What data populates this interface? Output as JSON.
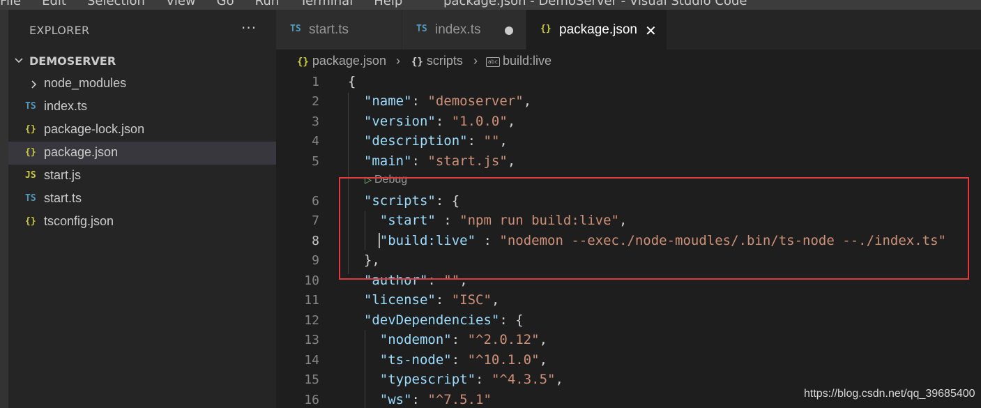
{
  "menubar": {
    "items": [
      "File",
      "Edit",
      "Selection",
      "View",
      "Go",
      "Run",
      "Terminal",
      "Help"
    ],
    "title": "package.json - DemoServer - Visual Studio Code"
  },
  "sidebar": {
    "header": "EXPLORER",
    "more": "···",
    "root": "DEMOSERVER",
    "items": [
      {
        "label": "node_modules",
        "icon": "chevron-right-icon",
        "type": "folder"
      },
      {
        "label": "index.ts",
        "icon": "TS",
        "type": "ts"
      },
      {
        "label": "package-lock.json",
        "icon": "{}",
        "type": "json"
      },
      {
        "label": "package.json",
        "icon": "{}",
        "type": "json",
        "selected": true
      },
      {
        "label": "start.js",
        "icon": "JS",
        "type": "js"
      },
      {
        "label": "start.ts",
        "icon": "TS",
        "type": "ts"
      },
      {
        "label": "tsconfig.json",
        "icon": "{}",
        "type": "json"
      }
    ]
  },
  "tabs": [
    {
      "label": "start.ts",
      "icon": "TS"
    },
    {
      "label": "index.ts",
      "icon": "TS",
      "modified": true
    },
    {
      "label": "package.json",
      "icon": "{}",
      "active": true,
      "close": "✕"
    }
  ],
  "breadcrumb": {
    "file_icon": "{}",
    "file": "package.json",
    "sep": "›",
    "section_icon": "{}",
    "section": "scripts",
    "leaf_icon": "abc",
    "leaf": "build:live"
  },
  "editor": {
    "codelens": "Debug",
    "lines": [
      {
        "n": "1",
        "code": [
          [
            "p",
            "{"
          ]
        ]
      },
      {
        "n": "2",
        "code": [
          [
            "p",
            "  "
          ],
          [
            "k",
            "\"name\""
          ],
          [
            "p",
            ": "
          ],
          [
            "s",
            "\"demoserver\""
          ],
          [
            "p",
            ","
          ]
        ]
      },
      {
        "n": "3",
        "code": [
          [
            "p",
            "  "
          ],
          [
            "k",
            "\"version\""
          ],
          [
            "p",
            ": "
          ],
          [
            "s",
            "\"1.0.0\""
          ],
          [
            "p",
            ","
          ]
        ]
      },
      {
        "n": "4",
        "code": [
          [
            "p",
            "  "
          ],
          [
            "k",
            "\"description\""
          ],
          [
            "p",
            ": "
          ],
          [
            "s",
            "\"\""
          ],
          [
            "p",
            ","
          ]
        ]
      },
      {
        "n": "5",
        "code": [
          [
            "p",
            "  "
          ],
          [
            "k",
            "\"main\""
          ],
          [
            "p",
            ": "
          ],
          [
            "s",
            "\"start.js\""
          ],
          [
            "p",
            ","
          ]
        ]
      },
      {
        "n": "6",
        "code": [
          [
            "p",
            "  "
          ],
          [
            "k",
            "\"scripts\""
          ],
          [
            "p",
            ": {"
          ]
        ]
      },
      {
        "n": "7",
        "code": [
          [
            "p",
            "    "
          ],
          [
            "k",
            "\"start\""
          ],
          [
            "p",
            " : "
          ],
          [
            "s",
            "\"npm run build:live\""
          ],
          [
            "p",
            ","
          ]
        ]
      },
      {
        "n": "8",
        "code": [
          [
            "p",
            "    "
          ],
          [
            "k",
            "\"build:live\""
          ],
          [
            "p",
            " : "
          ],
          [
            "s",
            "\"nodemon --exec./node-moudles/.bin/ts-node --./index.ts\""
          ]
        ]
      },
      {
        "n": "9",
        "code": [
          [
            "p",
            "  },"
          ]
        ]
      },
      {
        "n": "10",
        "code": [
          [
            "p",
            "  "
          ],
          [
            "k",
            "\"author\""
          ],
          [
            "p",
            ": "
          ],
          [
            "s",
            "\"\""
          ],
          [
            "p",
            ","
          ]
        ]
      },
      {
        "n": "11",
        "code": [
          [
            "p",
            "  "
          ],
          [
            "k",
            "\"license\""
          ],
          [
            "p",
            ": "
          ],
          [
            "s",
            "\"ISC\""
          ],
          [
            "p",
            ","
          ]
        ]
      },
      {
        "n": "12",
        "code": [
          [
            "p",
            "  "
          ],
          [
            "k",
            "\"devDependencies\""
          ],
          [
            "p",
            ": {"
          ]
        ]
      },
      {
        "n": "13",
        "code": [
          [
            "p",
            "    "
          ],
          [
            "k",
            "\"nodemon\""
          ],
          [
            "p",
            ": "
          ],
          [
            "s",
            "\"^2.0.12\""
          ],
          [
            "p",
            ","
          ]
        ]
      },
      {
        "n": "14",
        "code": [
          [
            "p",
            "    "
          ],
          [
            "k",
            "\"ts-node\""
          ],
          [
            "p",
            ": "
          ],
          [
            "s",
            "\"^10.1.0\""
          ],
          [
            "p",
            ","
          ]
        ]
      },
      {
        "n": "15",
        "code": [
          [
            "p",
            "    "
          ],
          [
            "k",
            "\"typescript\""
          ],
          [
            "p",
            ": "
          ],
          [
            "s",
            "\"^4.3.5\""
          ],
          [
            "p",
            ","
          ]
        ]
      },
      {
        "n": "16",
        "code": [
          [
            "p",
            "    "
          ],
          [
            "k",
            "\"ws\""
          ],
          [
            "p",
            ": "
          ],
          [
            "s",
            "\"^7.5.1\""
          ]
        ]
      }
    ]
  },
  "watermark": "https://blog.csdn.net/qq_39685400",
  "colors": {
    "key": "#9cdcfe",
    "string": "#ce9178",
    "highlight_box": "#e0393e",
    "ts_icon": "#519aba",
    "json_icon": "#cbcb41"
  }
}
